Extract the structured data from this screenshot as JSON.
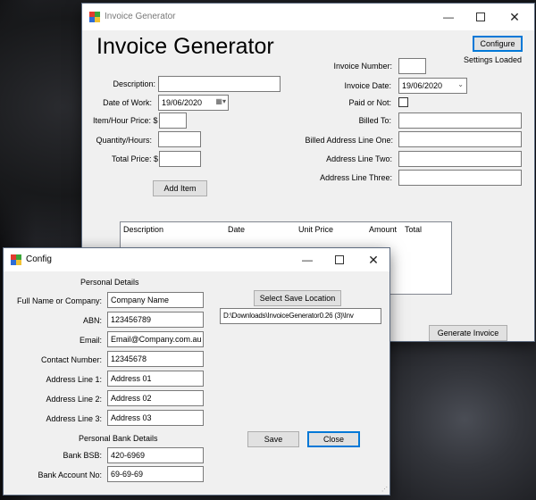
{
  "main": {
    "title": "Invoice Generator",
    "heading": "Invoice Generator",
    "configure_label": "Configure",
    "settings_status": "Settings Loaded",
    "description_label": "Description:",
    "date_of_work_label": "Date of Work:",
    "date_of_work_value": "19/06/2020",
    "item_price_label": "Item/Hour Price: $",
    "quantity_label": "Quantity/Hours:",
    "total_price_label": "Total Price: $",
    "add_item_label": "Add Item",
    "invoice_number_label": "Invoice Number:",
    "invoice_date_label": "Invoice Date:",
    "invoice_date_value": "19/06/2020",
    "paid_label": "Paid or Not:",
    "billed_to_label": "Billed To:",
    "billed_addr1_label": "Billed Address Line One:",
    "addr2_label": "Address Line Two:",
    "addr3_label": "Address Line Three:",
    "columns": [
      "Description",
      "Date",
      "Unit Price",
      "Amount",
      "Total"
    ],
    "generate_label": "Generate Invoice"
  },
  "config": {
    "title": "Config",
    "personal_header": "Personal Details",
    "full_name_label": "Full Name or Company:",
    "full_name_value": "Company Name",
    "abn_label": "ABN:",
    "abn_value": "123456789",
    "email_label": "Email:",
    "email_value": "Email@Company.com.au",
    "contact_label": "Contact Number:",
    "contact_value": "12345678",
    "addr1_label": "Address Line 1:",
    "addr1_value": "Address 01",
    "addr2_label": "Address Line 2:",
    "addr2_value": "Address 02",
    "addr3_label": "Address Line 3:",
    "addr3_value": "Address 03",
    "bank_header": "Personal Bank Details",
    "bsb_label": "Bank BSB:",
    "bsb_value": "420-6969",
    "account_label": "Bank Account No:",
    "account_value": "69-69-69",
    "save_location_label": "Select Save Location",
    "save_path": "D:\\Downloads\\InvoiceGenerator0.26 (3)\\Inv",
    "save_label": "Save",
    "close_label": "Close"
  }
}
